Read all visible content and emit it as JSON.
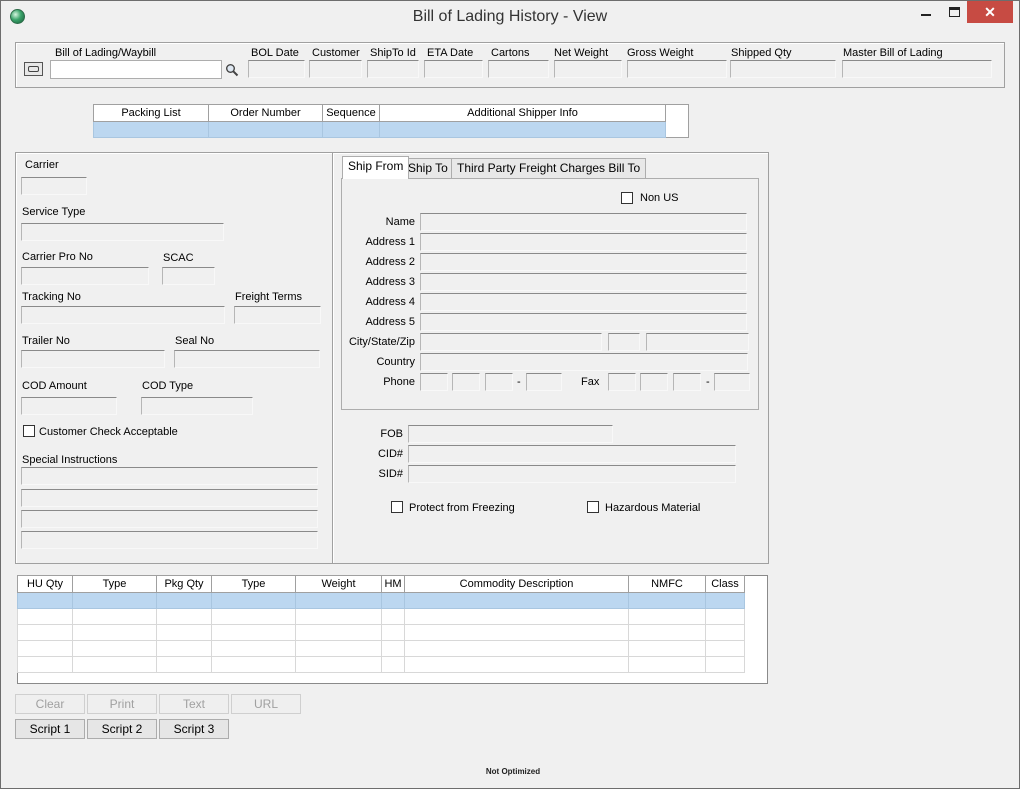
{
  "window": {
    "title": "Bill of Lading History - View"
  },
  "header": {
    "bol_label": "Bill of Lading/Waybill",
    "bol_value": "",
    "bol_date_label": "BOL Date",
    "customer_label": "Customer",
    "shipto_id_label": "ShipTo Id",
    "eta_date_label": "ETA Date",
    "cartons_label": "Cartons",
    "net_weight_label": "Net Weight",
    "gross_weight_label": "Gross Weight",
    "shipped_qty_label": "Shipped Qty",
    "master_bol_label": "Master Bill of Lading"
  },
  "packing_grid": {
    "columns": [
      "Packing List",
      "Order Number",
      "Sequence",
      "Additional Shipper Info"
    ]
  },
  "carrier_panel": {
    "carrier_label": "Carrier",
    "service_type_label": "Service Type",
    "carrier_pro_no_label": "Carrier Pro No",
    "scac_label": "SCAC",
    "tracking_no_label": "Tracking No",
    "freight_terms_label": "Freight Terms",
    "trailer_no_label": "Trailer No",
    "seal_no_label": "Seal No",
    "cod_amount_label": "COD Amount",
    "cod_type_label": "COD Type",
    "customer_check_label": "Customer Check Acceptable",
    "special_instructions_label": "Special Instructions"
  },
  "address_tabs": {
    "tabs": [
      "Ship From",
      "Ship To",
      "Third Party Freight Charges Bill To"
    ],
    "non_us_label": "Non US",
    "name_label": "Name",
    "address1_label": "Address 1",
    "address2_label": "Address 2",
    "address3_label": "Address 3",
    "address4_label": "Address 4",
    "address5_label": "Address 5",
    "city_state_zip_label": "City/State/Zip",
    "country_label": "Country",
    "phone_label": "Phone",
    "fax_label": "Fax",
    "dash": "-"
  },
  "shipping_misc": {
    "fob_label": "FOB",
    "cid_label": "CID#",
    "sid_label": "SID#",
    "protect_freezing_label": "Protect from Freezing",
    "hazardous_label": "Hazardous Material"
  },
  "commodity_grid": {
    "columns": [
      "HU Qty",
      "Type",
      "Pkg Qty",
      "Type",
      "Weight",
      "HM",
      "Commodity Description",
      "NMFC",
      "Class"
    ]
  },
  "buttons": {
    "clear": "Clear",
    "print": "Print",
    "text": "Text",
    "url": "URL",
    "script1": "Script 1",
    "script2": "Script 2",
    "script3": "Script 3"
  },
  "status": {
    "text": "Not Optimized"
  }
}
